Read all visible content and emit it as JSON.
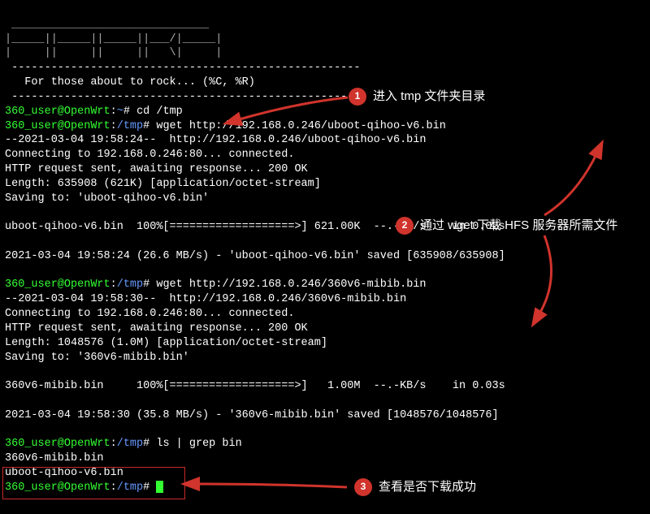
{
  "ascii": {
    "l1": " ______________________________ ",
    "l2": "|_____||_____||_____||___/|_____|",
    "l3": "|     ||     ||     ||   \\|     |"
  },
  "divider": " -----------------------------------------------------",
  "slogan": "   For those about to rock... (%C, %R)",
  "prompt": {
    "user_host": "360_user@OpenWrt",
    "home": "~",
    "tmp": "/tmp",
    "sep": ":",
    "suffix": "#"
  },
  "cmd": {
    "cd": "cd /tmp",
    "wget1": "wget http://192.168.0.246/uboot-qihoo-v6.bin",
    "wget2": "wget http://192.168.0.246/360v6-mibib.bin",
    "ls": "ls | grep bin"
  },
  "out": {
    "w1_l1": "--2021-03-04 19:58:24--  http://192.168.0.246/uboot-qihoo-v6.bin",
    "w1_l2": "Connecting to 192.168.0.246:80... connected.",
    "w1_l3": "HTTP request sent, awaiting response... 200 OK",
    "w1_l4": "Length: 635908 (621K) [application/octet-stream]",
    "w1_l5": "Saving to: 'uboot-qihoo-v6.bin'",
    "w1_prog": "uboot-qihoo-v6.bin  100%[===================>] 621.00K  --.-KB/s    in 0.02s",
    "w1_done": "2021-03-04 19:58:24 (26.6 MB/s) - 'uboot-qihoo-v6.bin' saved [635908/635908]",
    "w2_l1": "--2021-03-04 19:58:30--  http://192.168.0.246/360v6-mibib.bin",
    "w2_l2": "Connecting to 192.168.0.246:80... connected.",
    "w2_l3": "HTTP request sent, awaiting response... 200 OK",
    "w2_l4": "Length: 1048576 (1.0M) [application/octet-stream]",
    "w2_l5": "Saving to: '360v6-mibib.bin'",
    "w2_prog": "360v6-mibib.bin     100%[===================>]   1.00M  --.-KB/s    in 0.03s",
    "w2_done": "2021-03-04 19:58:30 (35.8 MB/s) - '360v6-mibib.bin' saved [1048576/1048576]",
    "ls_l1": "360v6-mibib.bin",
    "ls_l2": "uboot-qihoo-v6.bin"
  },
  "callouts": {
    "c1": {
      "num": "1",
      "label": "进入 tmp 文件夹目录"
    },
    "c2": {
      "num": "2",
      "label": "通过 wget 下载 HFS 服务器所需文件"
    },
    "c3": {
      "num": "3",
      "label": "查看是否下载成功"
    }
  }
}
